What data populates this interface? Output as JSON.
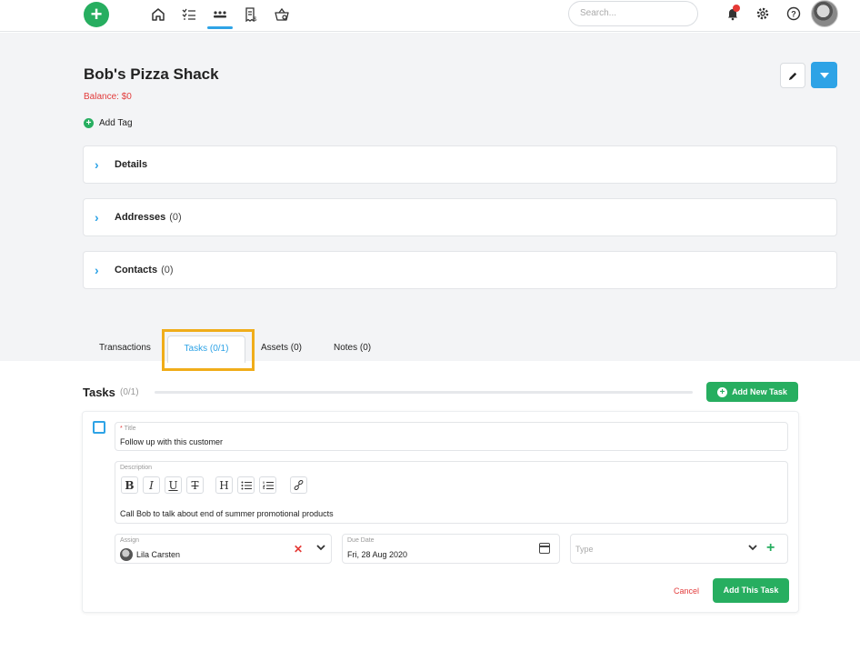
{
  "topbar": {
    "search_placeholder": "Search...",
    "nav_icons": [
      "home-icon",
      "task-list-icon",
      "contacts-icon",
      "invoice-icon",
      "basket-icon"
    ],
    "active_nav": "contacts-icon"
  },
  "header": {
    "title": "Bob's Pizza Shack",
    "balance": "Balance: $0",
    "add_tag": "Add Tag"
  },
  "panels": [
    {
      "label": "Details",
      "count": ""
    },
    {
      "label": "Addresses",
      "count": "(0)"
    },
    {
      "label": "Contacts",
      "count": "(0)"
    }
  ],
  "tabs": {
    "transactions": "Transactions",
    "tasks": "Tasks (0/1)",
    "assets": "Assets (0)",
    "notes": "Notes (0)",
    "active": "tasks"
  },
  "tasks": {
    "title": "Tasks",
    "count": "(0/1)",
    "add_new": "Add New Task",
    "form": {
      "title_label": "Title",
      "title_required_mark": "*",
      "title_value": "Follow up with this customer",
      "description_label": "Description",
      "description_value": "Call Bob to talk about end of summer promotional products",
      "toolbar": [
        "B",
        "I",
        "U",
        "T",
        "H"
      ],
      "assign_label": "Assign",
      "assign_value": "Lila Carsten",
      "due_label": "Due Date",
      "due_value": "Fri, 28 Aug 2020",
      "type_placeholder": "Type",
      "cancel": "Cancel",
      "submit": "Add This Task"
    }
  },
  "colors": {
    "accent": "#2ea3e6",
    "success": "#27ae60",
    "danger": "#e23b3b",
    "highlight": "#f0ad1a"
  }
}
